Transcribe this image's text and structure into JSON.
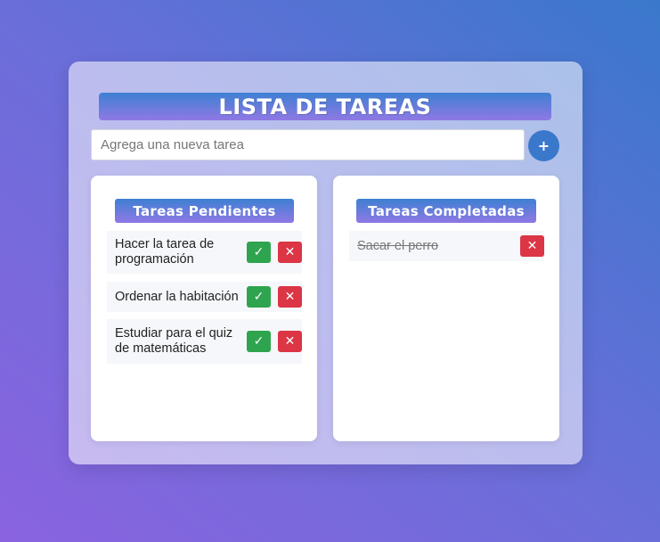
{
  "app": {
    "title": "LISTA DE TAREAS",
    "input_placeholder": "Agrega una nueva tarea",
    "add_button": "+"
  },
  "pending": {
    "title": "Tareas Pendientes",
    "tasks": [
      {
        "text": "Hacer la tarea de programación",
        "complete_icon": "✓",
        "delete_icon": "✕"
      },
      {
        "text": "Ordenar la habitación",
        "complete_icon": "✓",
        "delete_icon": "✕"
      },
      {
        "text": "Estudiar para el quiz de matemáticas",
        "complete_icon": "✓",
        "delete_icon": "✕"
      }
    ]
  },
  "completed": {
    "title": "Tareas Completadas",
    "tasks": [
      {
        "text": "Sacar el perro",
        "delete_icon": "✕"
      }
    ]
  },
  "colors": {
    "accent": "#3a78cc",
    "complete": "#2ea44f",
    "delete": "#dc3545"
  }
}
